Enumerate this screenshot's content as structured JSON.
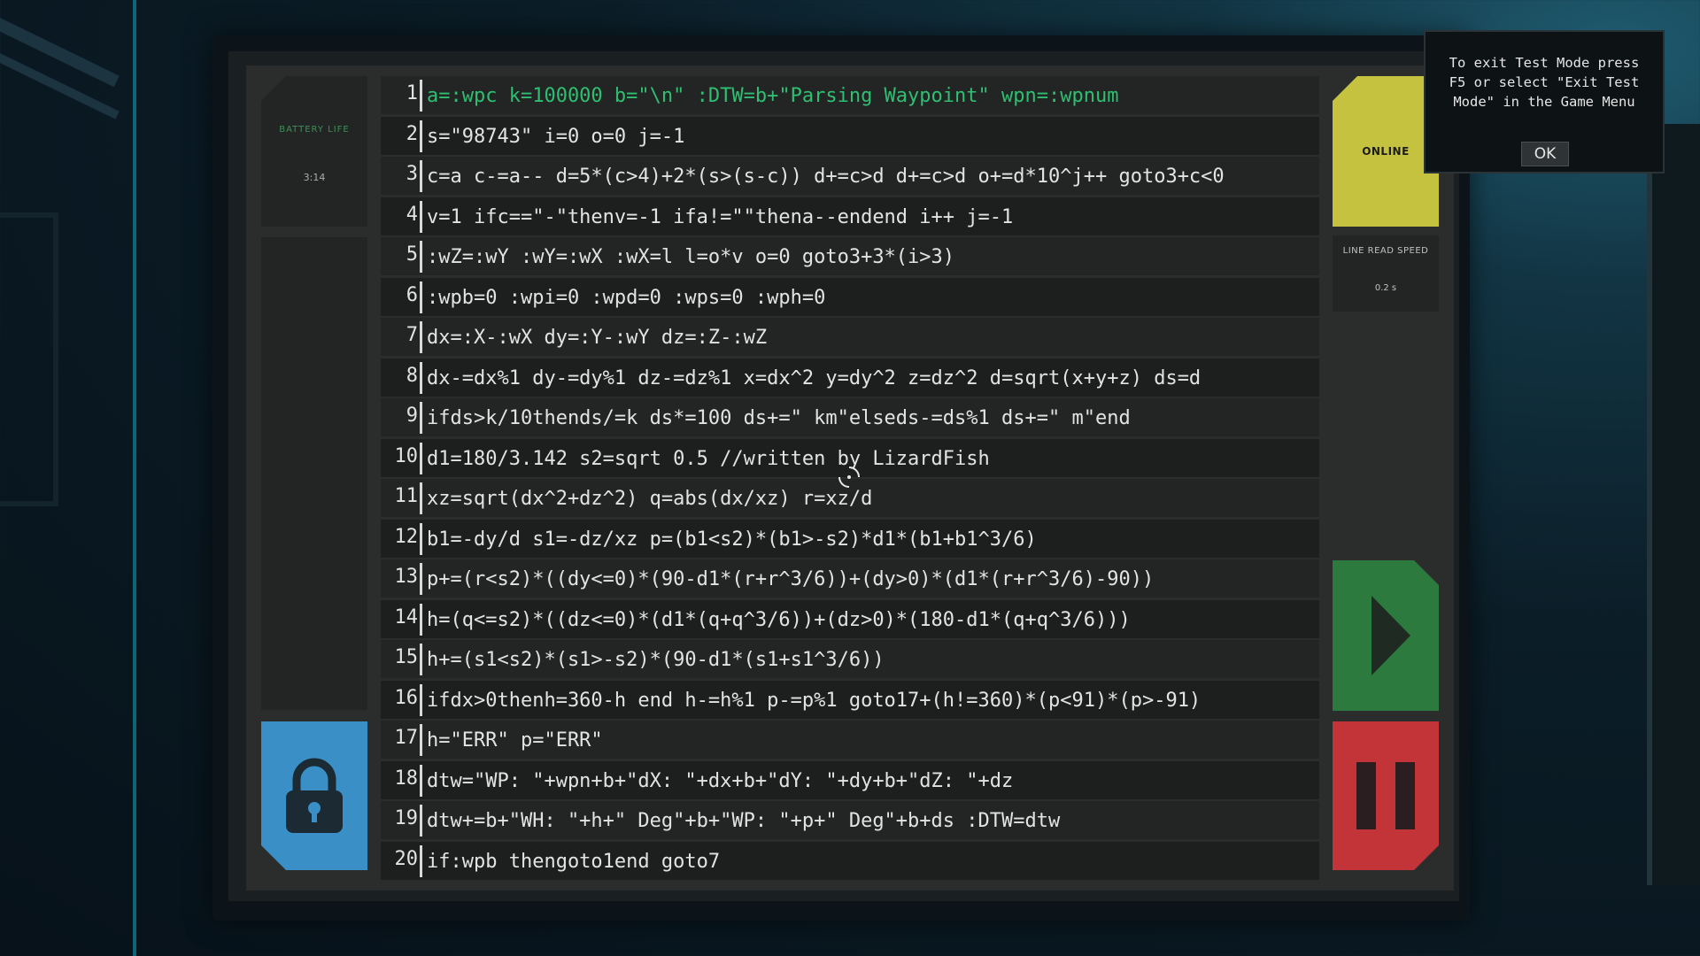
{
  "battery": {
    "label": "BATTERY LIFE",
    "value": "3:14"
  },
  "status": {
    "label": "ONLINE",
    "color": "#c5c23f"
  },
  "line_read_speed": {
    "label": "LINE READ SPEED",
    "value": "0.2 s"
  },
  "controls": {
    "lock_icon": "padlock-icon",
    "play_icon": "play-icon",
    "pause_icon": "pause-icon",
    "lock_color": "#3a8fc6",
    "play_color": "#2d7a3f",
    "pause_color": "#c23438"
  },
  "active_line": 1,
  "code_lines": [
    {
      "n": "1",
      "text": "a=:wpc k=100000 b=\"\\n\" :DTW=b+\"Parsing Waypoint\" wpn=:wpnum"
    },
    {
      "n": "2",
      "text": "s=\"98743\" i=0 o=0 j=-1"
    },
    {
      "n": "3",
      "text": "c=a c-=a-- d=5*(c>4)+2*(s>(s-c)) d+=c>d d+=c>d o+=d*10^j++ goto3+c<0"
    },
    {
      "n": "4",
      "text": "v=1 ifc==\"-\"thenv=-1 ifa!=\"\"thena--endend i++ j=-1"
    },
    {
      "n": "5",
      "text": ":wZ=:wY :wY=:wX :wX=l l=o*v o=0 goto3+3*(i>3)"
    },
    {
      "n": "6",
      "text": ":wpb=0 :wpi=0 :wpd=0 :wps=0 :wph=0"
    },
    {
      "n": "7",
      "text": "dx=:X-:wX dy=:Y-:wY dz=:Z-:wZ"
    },
    {
      "n": "8",
      "text": "dx-=dx%1 dy-=dy%1 dz-=dz%1 x=dx^2 y=dy^2 z=dz^2 d=sqrt(x+y+z) ds=d"
    },
    {
      "n": "9",
      "text": "ifds>k/10thends/=k ds*=100 ds+=\" km\"elseds-=ds%1 ds+=\" m\"end"
    },
    {
      "n": "10",
      "text": "d1=180/3.142 s2=sqrt 0.5 //written by LizardFish"
    },
    {
      "n": "11",
      "text": "xz=sqrt(dx^2+dz^2) q=abs(dx/xz) r=xz/d"
    },
    {
      "n": "12",
      "text": "b1=-dy/d s1=-dz/xz p=(b1<s2)*(b1>-s2)*d1*(b1+b1^3/6)"
    },
    {
      "n": "13",
      "text": "p+=(r<s2)*((dy<=0)*(90-d1*(r+r^3/6))+(dy>0)*(d1*(r+r^3/6)-90))"
    },
    {
      "n": "14",
      "text": "h=(q<=s2)*((dz<=0)*(d1*(q+q^3/6))+(dz>0)*(180-d1*(q+q^3/6)))"
    },
    {
      "n": "15",
      "text": "h+=(s1<s2)*(s1>-s2)*(90-d1*(s1+s1^3/6))"
    },
    {
      "n": "16",
      "text": "ifdx>0thenh=360-h end h-=h%1 p-=p%1 goto17+(h!=360)*(p<91)*(p>-91)"
    },
    {
      "n": "17",
      "text": "h=\"ERR\" p=\"ERR\""
    },
    {
      "n": "18",
      "text": "dtw=\"WP: \"+wpn+b+\"dX: \"+dx+b+\"dY: \"+dy+b+\"dZ: \"+dz"
    },
    {
      "n": "19",
      "text": "dtw+=b+\"WH: \"+h+\" Deg\"+b+\"WP: \"+p+\" Deg\"+b+ds :DTW=dtw"
    },
    {
      "n": "20",
      "text": "if:wpb thengoto1end goto7"
    }
  ],
  "dialog": {
    "message": "To exit Test Mode press\nF5 or select \"Exit Test\nMode\" in the Game Menu",
    "ok_label": "OK"
  }
}
